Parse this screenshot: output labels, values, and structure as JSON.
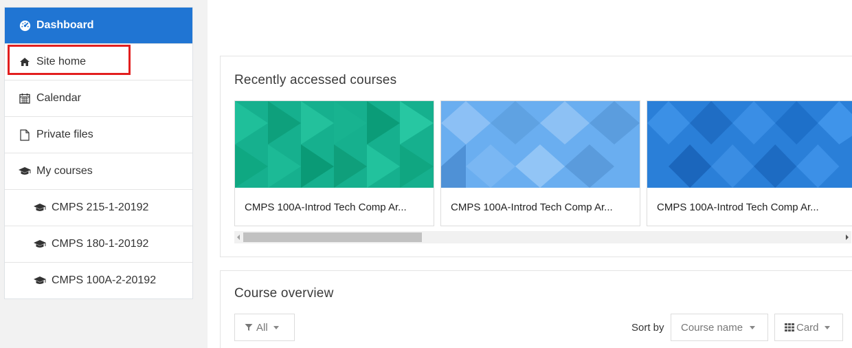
{
  "sidebar": {
    "items": [
      {
        "label": "Dashboard",
        "icon": "dashboard-icon",
        "active": true
      },
      {
        "label": "Site home",
        "icon": "home-icon"
      },
      {
        "label": "Calendar",
        "icon": "calendar-icon"
      },
      {
        "label": "Private files",
        "icon": "file-icon"
      },
      {
        "label": "My courses",
        "icon": "graduation-cap-icon"
      }
    ],
    "courses": [
      {
        "label": "CMPS 215-1-20192",
        "icon": "graduation-cap-icon"
      },
      {
        "label": "CMPS 180-1-20192",
        "icon": "graduation-cap-icon"
      },
      {
        "label": "CMPS 100A-2-20192",
        "icon": "graduation-cap-icon"
      }
    ]
  },
  "recent": {
    "title": "Recently accessed courses",
    "courses": [
      {
        "name": "CMPS 100A-Introd Tech Comp Ar...",
        "color": "#1abc9c"
      },
      {
        "name": "CMPS 100A-Introd Tech Comp Ar...",
        "color": "#6aaef0"
      },
      {
        "name": "CMPS 100A-Introd Tech Comp Ar...",
        "color": "#2a7fd8"
      }
    ]
  },
  "overview": {
    "title": "Course overview",
    "filter_label": "All",
    "sort_label": "Sort by",
    "sort_value": "Course name",
    "view_label": "Card"
  },
  "colors": {
    "accent": "#2075d3",
    "highlight": "#e21e1e"
  }
}
